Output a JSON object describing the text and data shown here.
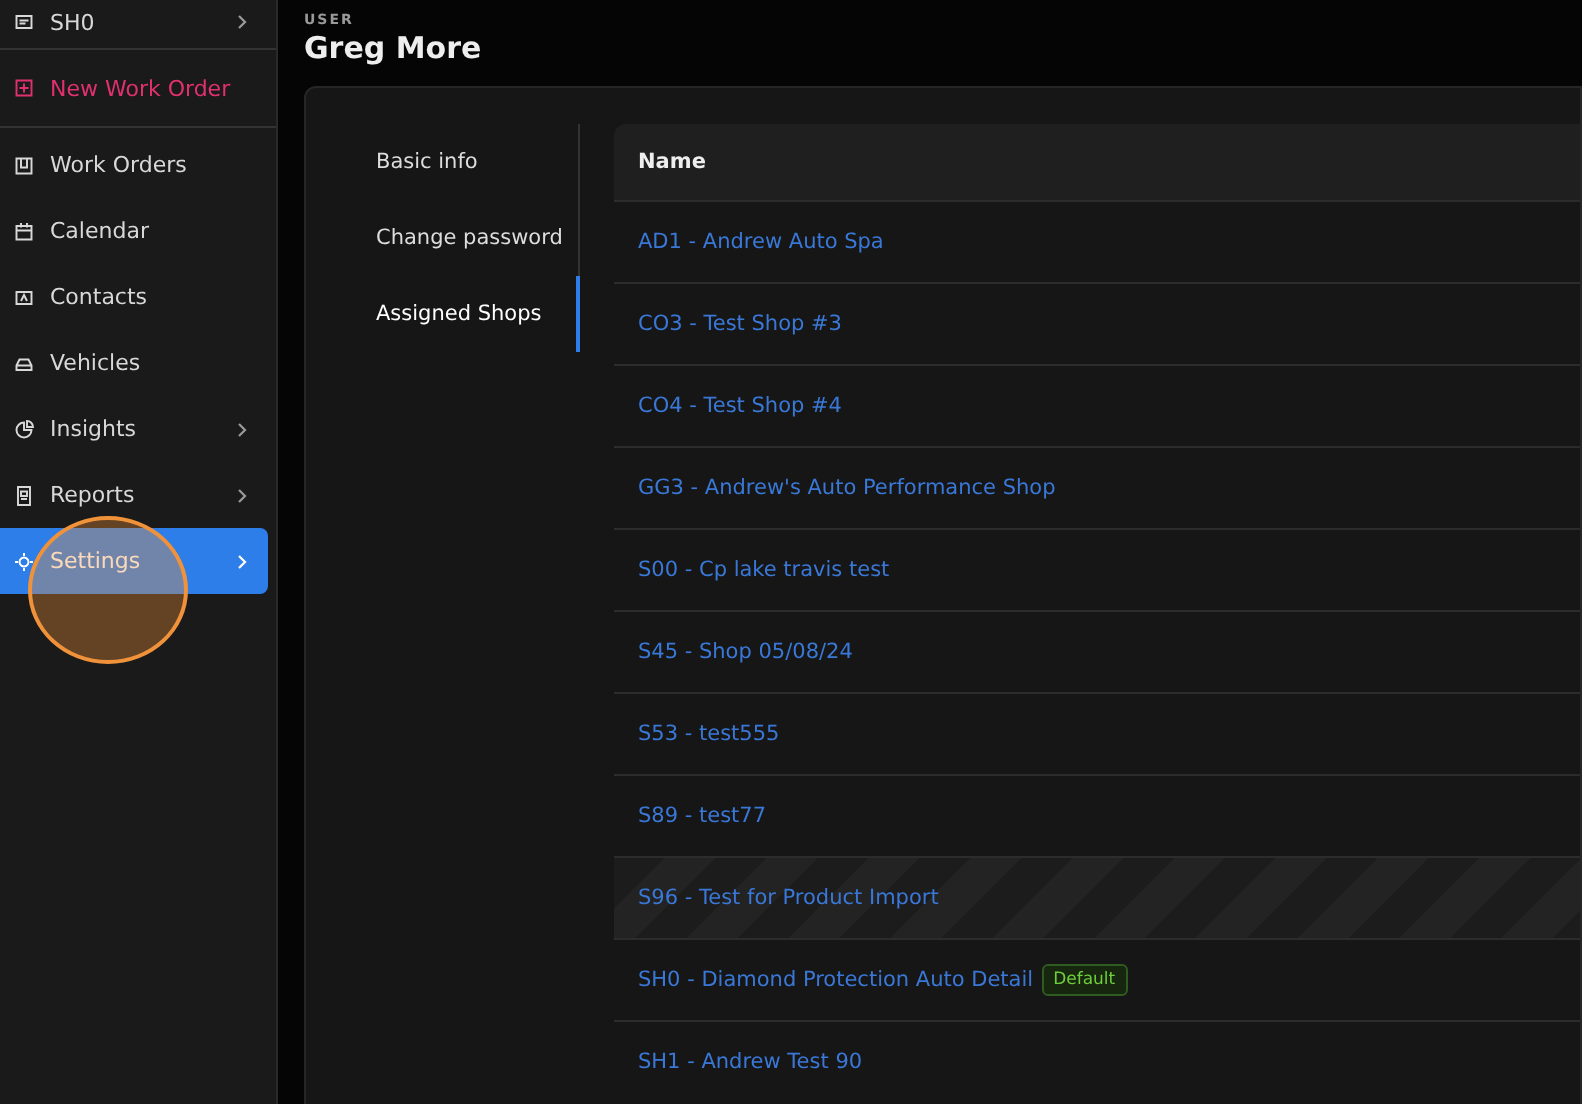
{
  "sidebar": {
    "items": [
      {
        "label": "SH0",
        "kind": "shop",
        "has_submenu": true,
        "selected": false
      },
      {
        "label": "New Work Order",
        "kind": "action",
        "has_submenu": false,
        "selected": false
      },
      {
        "label": "Work Orders",
        "kind": "nav",
        "has_submenu": false,
        "selected": false
      },
      {
        "label": "Calendar",
        "kind": "nav",
        "has_submenu": false,
        "selected": false
      },
      {
        "label": "Contacts",
        "kind": "nav",
        "has_submenu": false,
        "selected": false
      },
      {
        "label": "Vehicles",
        "kind": "nav",
        "has_submenu": false,
        "selected": false
      },
      {
        "label": "Insights",
        "kind": "nav",
        "has_submenu": true,
        "selected": false
      },
      {
        "label": "Reports",
        "kind": "nav",
        "has_submenu": true,
        "selected": false
      },
      {
        "label": "Settings",
        "kind": "nav",
        "has_submenu": true,
        "selected": true
      }
    ]
  },
  "header": {
    "eyebrow": "USER",
    "title": "Greg More"
  },
  "tabs": [
    {
      "label": "Basic info",
      "selected": false
    },
    {
      "label": "Change password",
      "selected": false
    },
    {
      "label": "Assigned Shops",
      "selected": true
    }
  ],
  "table": {
    "columns": [
      "Name"
    ],
    "rows": [
      {
        "name": "AD1 - Andrew Auto Spa",
        "hovered": false
      },
      {
        "name": "CO3 - Test Shop #3",
        "hovered": false
      },
      {
        "name": "CO4 - Test Shop #4",
        "hovered": false
      },
      {
        "name": "GG3 - Andrew's Auto Performance Shop",
        "hovered": false
      },
      {
        "name": "S00 - Cp lake travis test",
        "hovered": false
      },
      {
        "name": "S45 - Shop 05/08/24",
        "hovered": false
      },
      {
        "name": "S53 - test555",
        "hovered": false
      },
      {
        "name": "S89 - test77",
        "hovered": false
      },
      {
        "name": "S96 - Test for Product Import",
        "hovered": true
      },
      {
        "name": "SH0 - Diamond Protection Auto Detail",
        "hovered": false,
        "badge": "Default"
      },
      {
        "name": "SH1 - Andrew Test 90",
        "hovered": false
      }
    ]
  }
}
